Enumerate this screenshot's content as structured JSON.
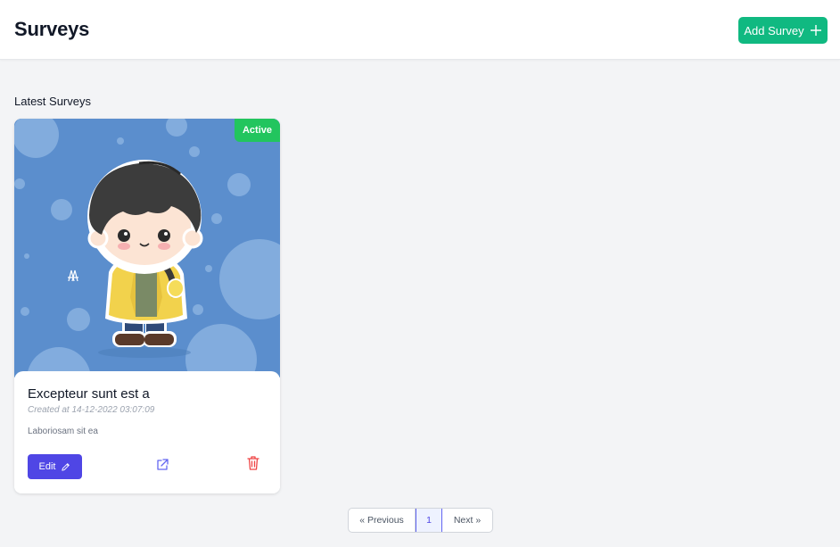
{
  "header": {
    "title": "Surveys",
    "add_button_label": "Add Survey"
  },
  "main": {
    "section_title": "Latest Surveys"
  },
  "surveys": [
    {
      "status": "Active",
      "title": "Excepteur sunt est a",
      "created": "Created at 14-12-2022 03:07:09",
      "description": "Laboriosam sit ea",
      "edit_label": "Edit"
    }
  ],
  "pagination": {
    "previous_label": "« Previous",
    "current_page": "1",
    "next_label": "Next »"
  },
  "colors": {
    "add_button": "#10b981",
    "badge_active": "#22c55e",
    "edit_button": "#4f46e5",
    "link_icon": "#6366f1",
    "delete_icon": "#ef4444",
    "image_background": "#5b8ecd"
  },
  "icons": [
    "plus-icon",
    "pencil-icon",
    "external-link-icon",
    "trash-icon"
  ]
}
